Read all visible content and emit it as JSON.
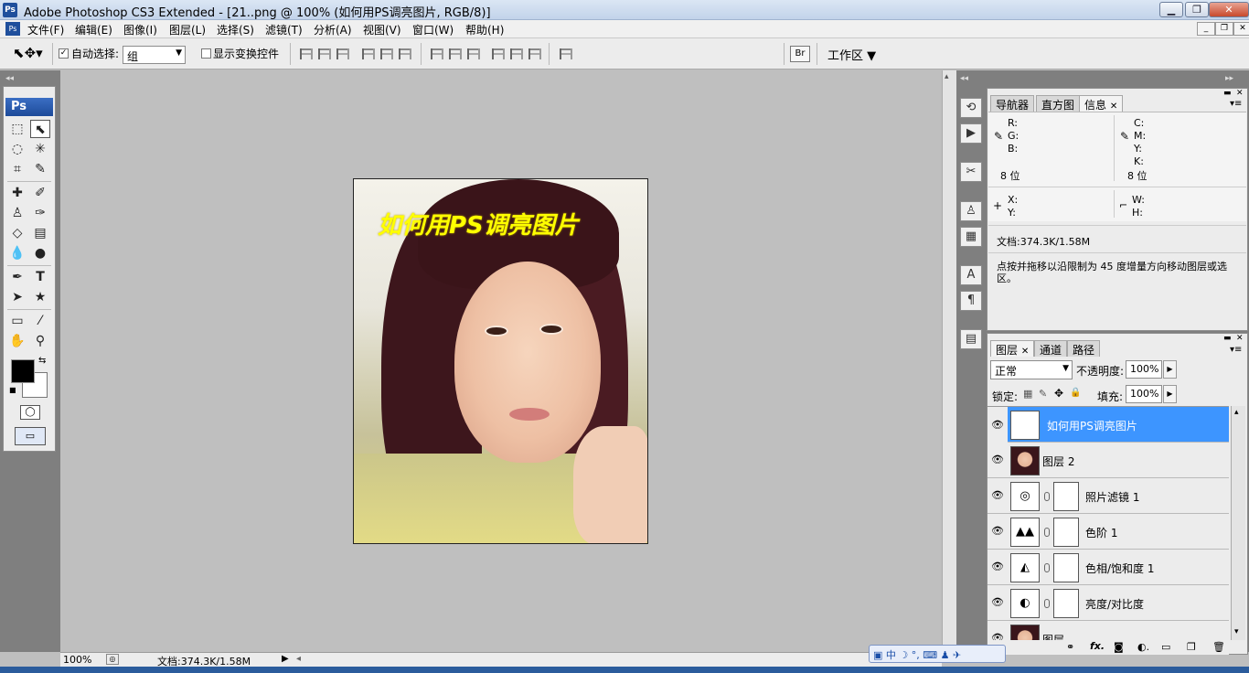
{
  "window": {
    "app_icon": "Ps",
    "title": "Adobe Photoshop CS3 Extended - [21..png @ 100% (如何用PS调亮图片, RGB/8)]",
    "controls": [
      "minimize-icon",
      "restore-icon",
      "close-icon"
    ]
  },
  "menu": {
    "items": [
      "文件(F)",
      "编辑(E)",
      "图像(I)",
      "图层(L)",
      "选择(S)",
      "滤镜(T)",
      "分析(A)",
      "视图(V)",
      "窗口(W)",
      "帮助(H)"
    ]
  },
  "options": {
    "auto_select_label": "自动选择:",
    "auto_select_checked": true,
    "auto_select_value": "组",
    "show_transform_label": "显示变换控件",
    "show_transform_checked": false,
    "workspace_label": "工作区"
  },
  "toolbox": {
    "logo": "Ps"
  },
  "document": {
    "overlay_text": "如何用PS调亮图片"
  },
  "status": {
    "zoom": "100%",
    "doc_info": "文档:374.3K/1.58M"
  },
  "info_panel": {
    "tabs": [
      "导航器",
      "直方图",
      "信息"
    ],
    "active_tab": "信息",
    "rgb_labels": [
      "R:",
      "G:",
      "B:"
    ],
    "cmyk_labels": [
      "C:",
      "M:",
      "Y:",
      "K:"
    ],
    "bit_left": "8 位",
    "bit_right": "8 位",
    "xy_labels": [
      "X:",
      "Y:"
    ],
    "wh_labels": [
      "W:",
      "H:"
    ],
    "doc_info": "文档:374.3K/1.58M",
    "hint": "点按并拖移以沿限制为 45 度增量方向移动图层或选区。"
  },
  "layers_panel": {
    "tabs": [
      "图层",
      "通道",
      "路径"
    ],
    "active_tab": "图层",
    "blend_mode": "正常",
    "opacity_label": "不透明度:",
    "opacity_value": "100%",
    "lock_label": "锁定:",
    "fill_label": "填充:",
    "fill_value": "100%",
    "layers": [
      {
        "name": "如何用PS调亮图片",
        "type": "text",
        "active": true
      },
      {
        "name": "图层 2",
        "type": "image",
        "active": false
      },
      {
        "name": "照片滤镜 1",
        "type": "adjustment",
        "active": false
      },
      {
        "name": "色阶 1",
        "type": "adjustment",
        "active": false
      },
      {
        "name": "色相/饱和度 1",
        "type": "adjustment",
        "active": false
      },
      {
        "name": "亮度/对比度",
        "type": "adjustment",
        "active": false
      },
      {
        "name": "图层",
        "type": "image",
        "active": false
      }
    ]
  },
  "ime_bar": {
    "label": "中"
  }
}
